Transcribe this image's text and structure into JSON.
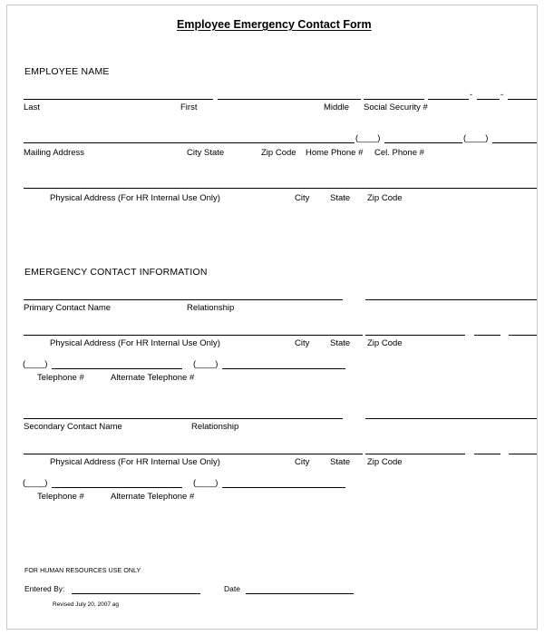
{
  "document": {
    "title": "Employee Emergency Contact Form"
  },
  "employee_section": {
    "heading": "EMPLOYEE NAME",
    "name_row_labels": {
      "last": "Last",
      "first": "First",
      "middle": "Middle",
      "social_security": "Social Security #"
    },
    "address_row_labels": {
      "mailing_address": "Mailing Address",
      "city_state": "City State",
      "zip_code": "Zip Code",
      "home_phone": "Home Phone #",
      "cell_phone": "Cel. Phone #"
    },
    "physical_row_labels": {
      "physical_address": "Physical Address (For HR Internal Use Only)",
      "city": "City",
      "state": "State",
      "zip_code": "Zip Code"
    },
    "phone_area_code_mark": "(____)"
  },
  "emergency_section": {
    "heading": "EMERGENCY CONTACT INFORMATION",
    "primary": {
      "contact_name": "Primary Contact Name",
      "relationship": "Relationship",
      "physical_address": "Physical Address (For HR Internal Use Only)",
      "city": "City",
      "state": "State",
      "zip_code": "Zip Code",
      "telephone": "Telephone #",
      "alternate_telephone": "Alternate Telephone #",
      "area_code_mark": "(____)"
    },
    "secondary": {
      "contact_name": "Secondary Contact Name",
      "relationship": "Relationship",
      "physical_address": "Physical Address (For HR Internal Use Only)",
      "city": "City",
      "state": "State",
      "zip_code": "Zip Code",
      "telephone": "Telephone #",
      "alternate_telephone": "Alternate Telephone #",
      "area_code_mark": "(____)"
    }
  },
  "footer": {
    "hr_use_only": "FOR HUMAN RESOURCES USE ONLY",
    "entered_by_label": "Entered By:",
    "entered_by_line": "_____________________________",
    "date_label": "Date",
    "date_line": "___________________",
    "revision": "Revised July 20, 2007 ag"
  },
  "ssn_separators": {
    "first": "-",
    "second": "-"
  },
  "colors": {
    "text": "#000000",
    "rule": "#000000",
    "page_border": "#c8c8c8",
    "background": "#ffffff"
  }
}
